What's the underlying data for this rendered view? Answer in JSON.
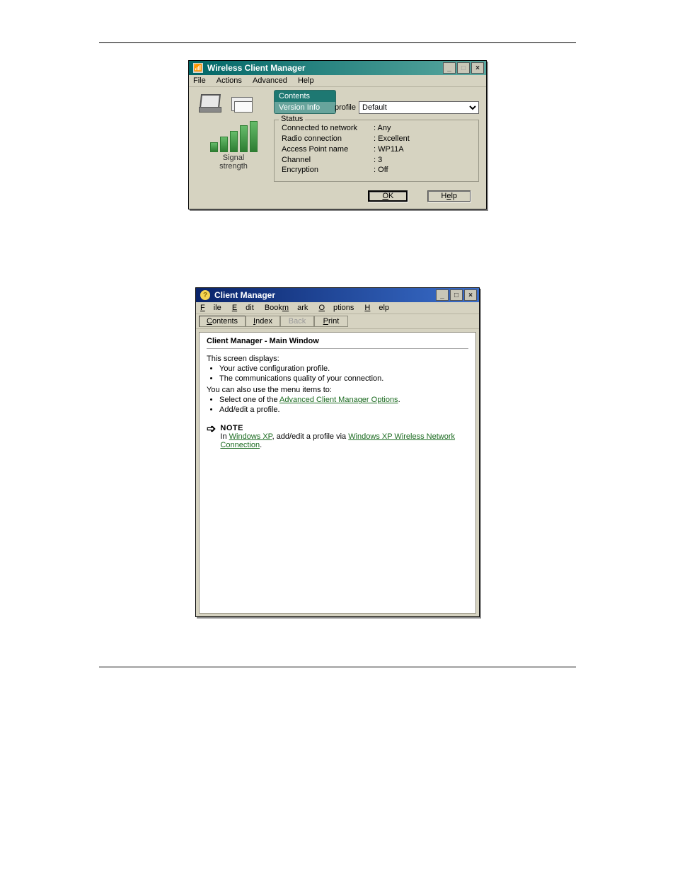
{
  "win1": {
    "title": "Wireless Client Manager",
    "appIconGlyph": "📶",
    "menus": {
      "file": "File",
      "actions": "Actions",
      "advanced": "Advanced",
      "help": "Help"
    },
    "tabs": {
      "contents": "Contents",
      "version": "Version Info"
    },
    "profileLabel": "profile",
    "profileSelected": "Default",
    "statusLegend": "Status",
    "statusRows": [
      {
        "label": "Connected to network",
        "value": ": Any"
      },
      {
        "label": "Radio connection",
        "value": ": Excellent"
      },
      {
        "label": "Access Point name",
        "value": ": WP11A"
      },
      {
        "label": "Channel",
        "value": ": 3"
      },
      {
        "label": "Encryption",
        "value": ": Off"
      }
    ],
    "signalLabel1": "Signal",
    "signalLabel2": "strength",
    "okLabel": "OK",
    "helpLabel": "Help"
  },
  "win2": {
    "title": "Client Manager",
    "appIconGlyph": "?",
    "menus": {
      "file": "File",
      "edit": "Edit",
      "bookmark": "Bookmark",
      "options": "Options",
      "help": "Help"
    },
    "toolbar": {
      "contents": "Contents",
      "index": "Index",
      "back": "Back",
      "print": "Print"
    },
    "heading": "Client Manager - Main Window",
    "intro": "This screen displays:",
    "bullets1": [
      "Your active configuration profile.",
      "The communications quality of your connection."
    ],
    "intro2": "You can also use the menu items to:",
    "bullet2a_prefix": "Select one of the ",
    "bullet2a_link": "Advanced Client Manager Options",
    "bullet2a_suffix": ".",
    "bullet2b": "Add/edit a profile.",
    "noteTitle": "NOTE",
    "noteText_prefix": "In ",
    "noteLink1": "Windows XP",
    "noteText_mid": ", add/edit a profile via ",
    "noteLink2": "Windows XP Wireless Network Connection",
    "noteText_suffix": "."
  }
}
